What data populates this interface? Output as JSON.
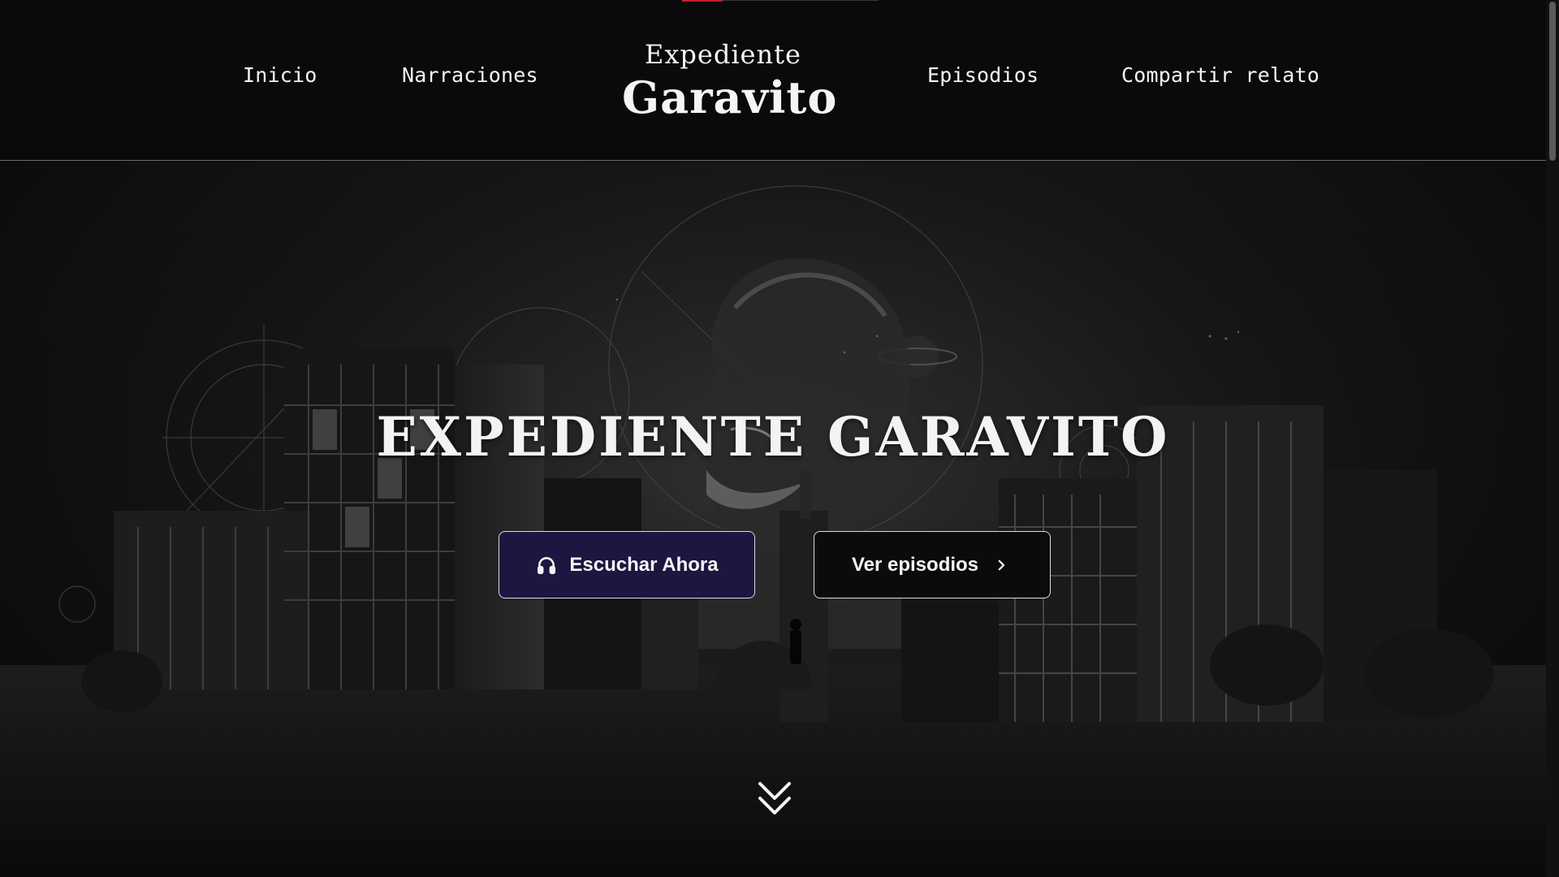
{
  "header": {
    "nav_left": [
      {
        "label": "Inicio"
      },
      {
        "label": "Narraciones"
      }
    ],
    "nav_right": [
      {
        "label": "Episodios"
      },
      {
        "label": "Compartir relato"
      }
    ],
    "logo": {
      "line1": "Expediente",
      "line2": "Garavito"
    }
  },
  "hero": {
    "title": "EXPEDIENTE GARAVITO",
    "primary_button": {
      "label": "Escuchar Ahora",
      "icon": "headphones-icon"
    },
    "secondary_button": {
      "label": "Ver episodios",
      "icon": "chevron-right-icon"
    },
    "scroll_indicator_icon": "double-chevron-down-icon"
  },
  "colors": {
    "background": "#0a0909",
    "primary_button_bg": "#1c1740",
    "accent": "#c0202a"
  }
}
